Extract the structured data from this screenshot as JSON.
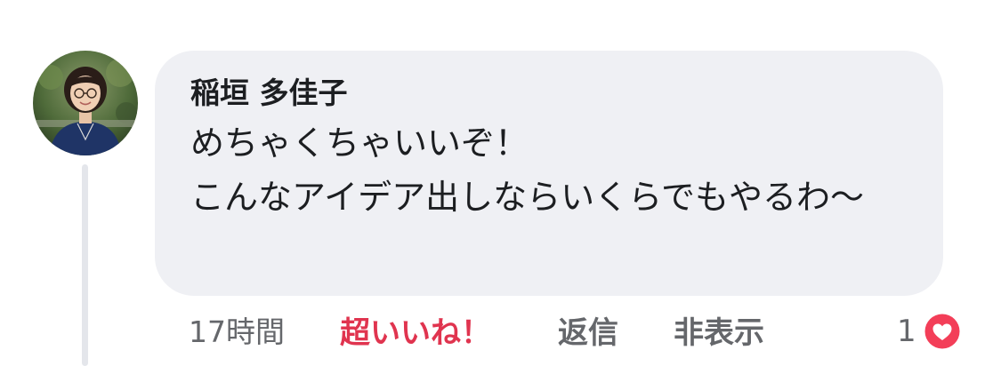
{
  "comment": {
    "author": "稲垣 多佳子",
    "body": "めちゃくちゃいいぞ！\nこんなアイデア出しならいくらでもやるわ〜",
    "timestamp": "17時間",
    "actions": {
      "like_label": "超いいね！",
      "reply_label": "返信",
      "hide_label": "非表示"
    },
    "reactions": {
      "count": "1",
      "icon": "love-heart-icon",
      "color": "#f33e58"
    }
  },
  "colors": {
    "bubble_bg": "#eff0f4",
    "text_primary": "#1c1e21",
    "text_secondary": "#65676b",
    "like_active": "#e0344f",
    "thread_line": "#e4e6eb"
  }
}
